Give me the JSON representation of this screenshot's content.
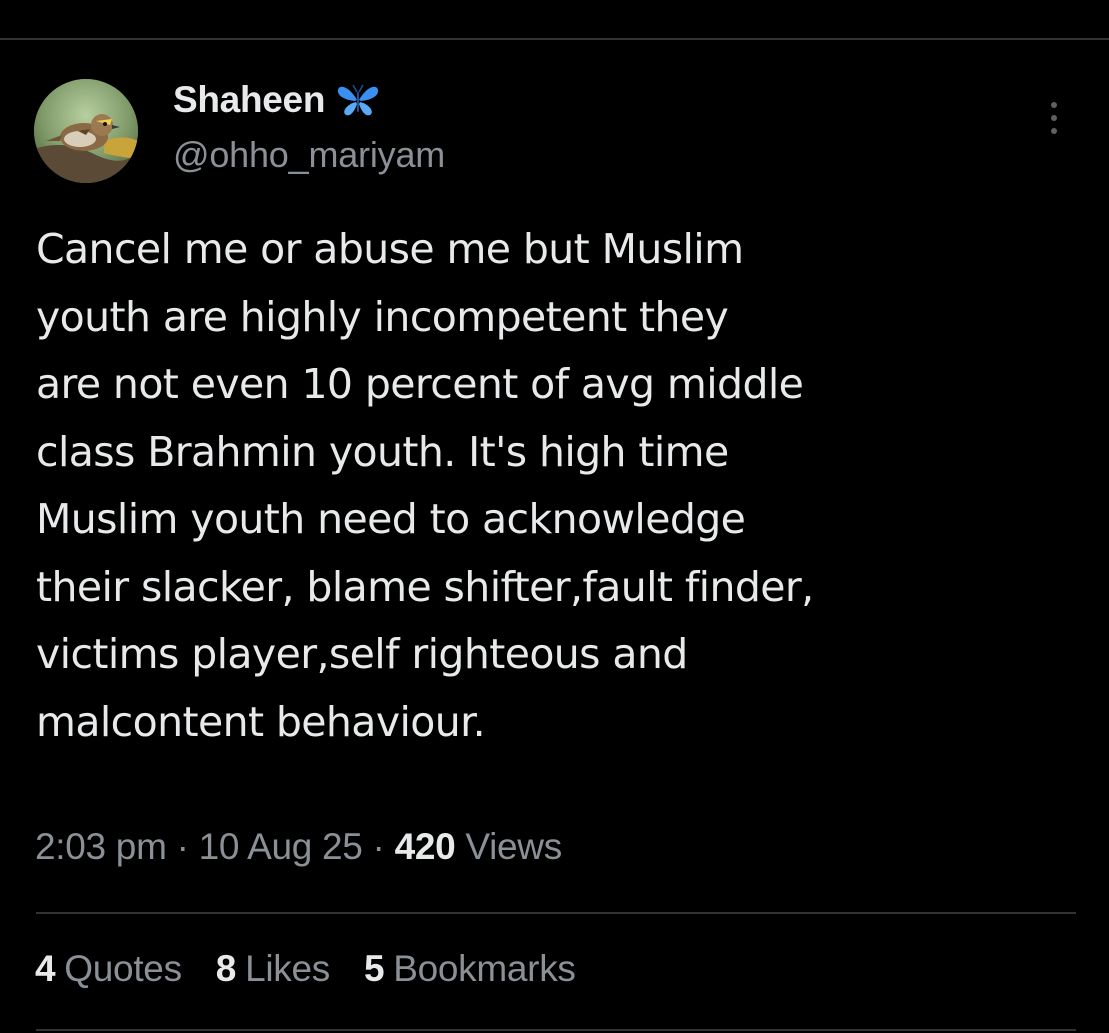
{
  "author": {
    "display_name": "Shaheen",
    "handle": "@ohho_mariyam",
    "badge_icon": "butterfly-icon",
    "badge_color": "#3b8ff0"
  },
  "tweet": {
    "text": "Cancel me or abuse me but Muslim\nyouth are highly incompetent they\nare not even 10 percent of avg middle\nclass Brahmin youth. It's high time\nMuslim youth need to acknowledge\ntheir slacker, blame shifter,fault finder,\nvictims player,self righteous and\nmalcontent behaviour."
  },
  "meta": {
    "time": "2:03 pm",
    "separator": "·",
    "date": "10 Aug 25",
    "views_count": "420",
    "views_label": "Views"
  },
  "stats": {
    "quotes_count": "4",
    "quotes_label": "Quotes",
    "likes_count": "8",
    "likes_label": "Likes",
    "bookmarks_count": "5",
    "bookmarks_label": "Bookmarks"
  },
  "colors": {
    "background": "#000000",
    "primary_text": "#e7e9ea",
    "secondary_text": "#8b9096",
    "divider": "#2f3336"
  }
}
